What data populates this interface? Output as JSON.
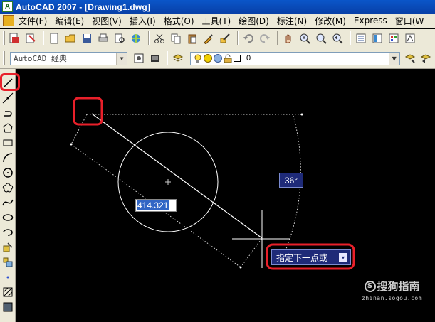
{
  "window": {
    "app_icon_label": "A",
    "title": "AutoCAD 2007 - [Drawing1.dwg]"
  },
  "menu": {
    "items": [
      "文件(F)",
      "编辑(E)",
      "视图(V)",
      "插入(I)",
      "格式(O)",
      "工具(T)",
      "绘图(D)",
      "标注(N)",
      "修改(M)",
      "Express",
      "窗口(W"
    ]
  },
  "toolbar": {
    "workspace_value": "AutoCAD 经典",
    "layer_value": "0"
  },
  "canvas": {
    "dynamic_length_value": "414.321",
    "dynamic_angle_value": "36°",
    "command_prompt": "指定下一点或",
    "prompt_dropdown_glyph": "▾"
  },
  "watermark": {
    "brand": "搜狗指南",
    "brand_logo_letter": "S",
    "site": "zhinan.sogou.com"
  },
  "colors": {
    "canvas_bg": "#000000",
    "highlight_frame": "#e8202a",
    "dyn_tooltip_bg": "#1e2a78",
    "selection_blue": "#3166c5",
    "chrome_bg": "#ece9d8",
    "title_bar": "#0a56c9"
  }
}
